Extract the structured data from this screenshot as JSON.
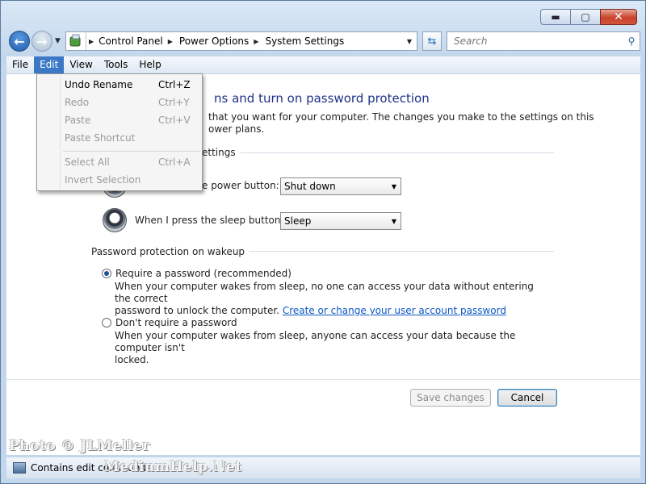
{
  "window": {
    "controls": {
      "minimize": "▬",
      "maximize": "▢",
      "close": "✕"
    }
  },
  "address": {
    "breadcrumbs": [
      "Control Panel",
      "Power Options",
      "System Settings"
    ],
    "search_placeholder": "Search"
  },
  "menubar": {
    "items": [
      "File",
      "Edit",
      "View",
      "Tools",
      "Help"
    ],
    "active": "Edit"
  },
  "edit_menu": {
    "items": [
      {
        "label": "Undo Rename",
        "shortcut": "Ctrl+Z",
        "enabled": true
      },
      {
        "label": "Redo",
        "shortcut": "Ctrl+Y",
        "enabled": false
      },
      {
        "label": "Paste",
        "shortcut": "Ctrl+V",
        "enabled": false
      },
      {
        "label": "Paste Shortcut",
        "shortcut": "",
        "enabled": false
      },
      {
        "label": "Select All",
        "shortcut": "Ctrl+A",
        "enabled": false
      },
      {
        "label": "Invert Selection",
        "shortcut": "",
        "enabled": false
      }
    ]
  },
  "page": {
    "heading_visible": "ns and turn on password protection",
    "desc_line1": "that you want for your computer. The changes you make to the settings on this",
    "desc_line2": "ower plans.",
    "section_buttons_visible": "ettings",
    "power_button_label_visible": "e power button:",
    "power_button_value": "Shut down",
    "sleep_button_label": "When I press the sleep button:",
    "sleep_button_value": "Sleep",
    "section_password": "Password protection on wakeup",
    "require_label": "Require a password (recommended)",
    "require_desc_line1": "When your computer wakes from sleep, no one can access your data without entering the correct",
    "require_desc_line2_prefix": "password to unlock the computer. ",
    "require_link": "Create or change your user account password",
    "norequire_label": "Don't require a password",
    "norequire_desc_line1": "When your computer wakes from sleep, anyone can access your data because the computer isn't",
    "norequire_desc_line2": "locked.",
    "selected_option": "require"
  },
  "buttons": {
    "save": "Save changes",
    "cancel": "Cancel"
  },
  "status": {
    "text": "Contains edit commands."
  },
  "watermark": {
    "line1": "Photo © JLMeller",
    "line2": "MediumHelp.Net"
  }
}
